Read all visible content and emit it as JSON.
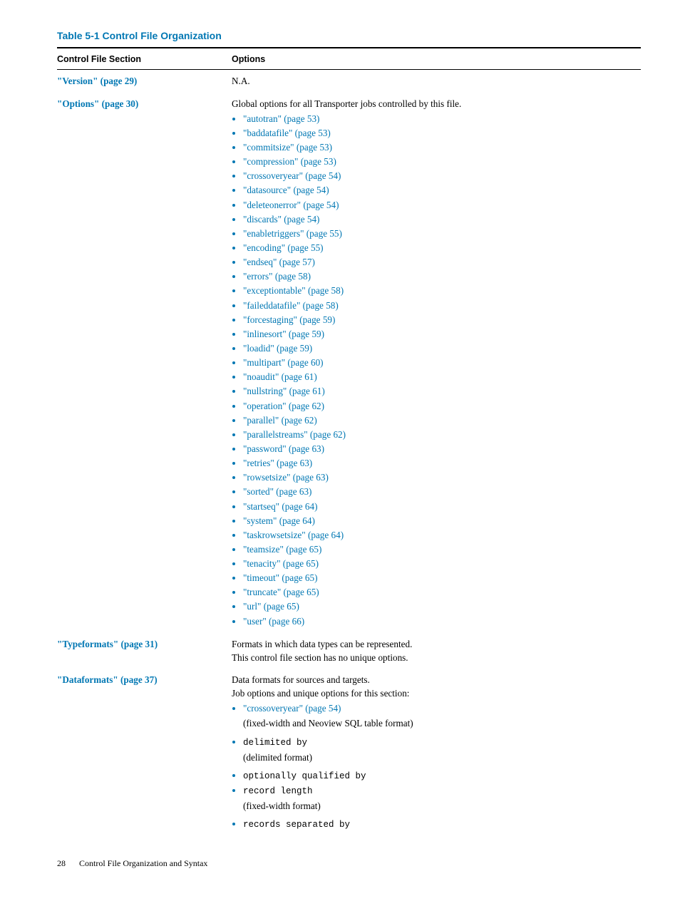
{
  "table_title": "Table 5-1 Control File Organization",
  "headers": {
    "col1": "Control File Section",
    "col2": "Options"
  },
  "rows": {
    "version": {
      "section": "\"Version\" (page 29)",
      "desc": "N.A."
    },
    "options": {
      "section": "\"Options\" (page 30)",
      "desc": "Global options for all Transporter jobs controlled by this file.",
      "items": [
        "\"autotran\" (page 53)",
        "\"baddatafile\" (page 53)",
        "\"commitsize\" (page 53)",
        "\"compression\" (page 53)",
        "\"crossoveryear\" (page 54)",
        "\"datasource\" (page 54)",
        "\"deleteonerror\" (page 54)",
        "\"discards\" (page 54)",
        "\"enabletriggers\" (page 55)",
        "\"encoding\" (page 55)",
        "\"endseq\" (page 57)",
        "\"errors\" (page 58)",
        "\"exceptiontable\" (page 58)",
        "\"faileddatafile\" (page 58)",
        "\"forcestaging\" (page 59)",
        "\"inlinesort\" (page 59)",
        "\"loadid\" (page 59)",
        "\"multipart\" (page 60)",
        "\"noaudit\" (page 61)",
        "\"nullstring\" (page 61)",
        "\"operation\" (page 62)",
        "\"parallel\" (page 62)",
        "\"parallelstreams\" (page 62)",
        "\"password\" (page 63)",
        "\"retries\" (page 63)",
        "\"rowsetsize\" (page 63)",
        "\"sorted\" (page 63)",
        "\"startseq\" (page 64)",
        "\"system\" (page 64)",
        "\"taskrowsetsize\" (page 64)",
        "\"teamsize\" (page 65)",
        "\"tenacity\" (page 65)",
        "\"timeout\" (page 65)",
        "\"truncate\" (page 65)",
        "\"url\" (page 65)",
        "\"user\" (page 66)"
      ]
    },
    "typeformats": {
      "section": "\"Typeformats\" (page 31)",
      "desc1": "Formats in which data types can be represented.",
      "desc2": "This control file section has no unique options."
    },
    "dataformats": {
      "section": "\"Dataformats\" (page 37)",
      "desc1": "Data formats for sources and targets.",
      "desc2": "Job options and unique options for this section:",
      "item1_link": "\"crossoveryear\" (page 54)",
      "item1_note": "(fixed-width and Neoview SQL table format)",
      "item2_code": "delimited by",
      "item2_note": "(delimited format)",
      "item3_code": "optionally qualified by",
      "item4_code": "record length",
      "item4_note": "(fixed-width format)",
      "item5_code": "records separated by"
    }
  },
  "footer": {
    "page": "28",
    "title": "Control File Organization and Syntax"
  }
}
